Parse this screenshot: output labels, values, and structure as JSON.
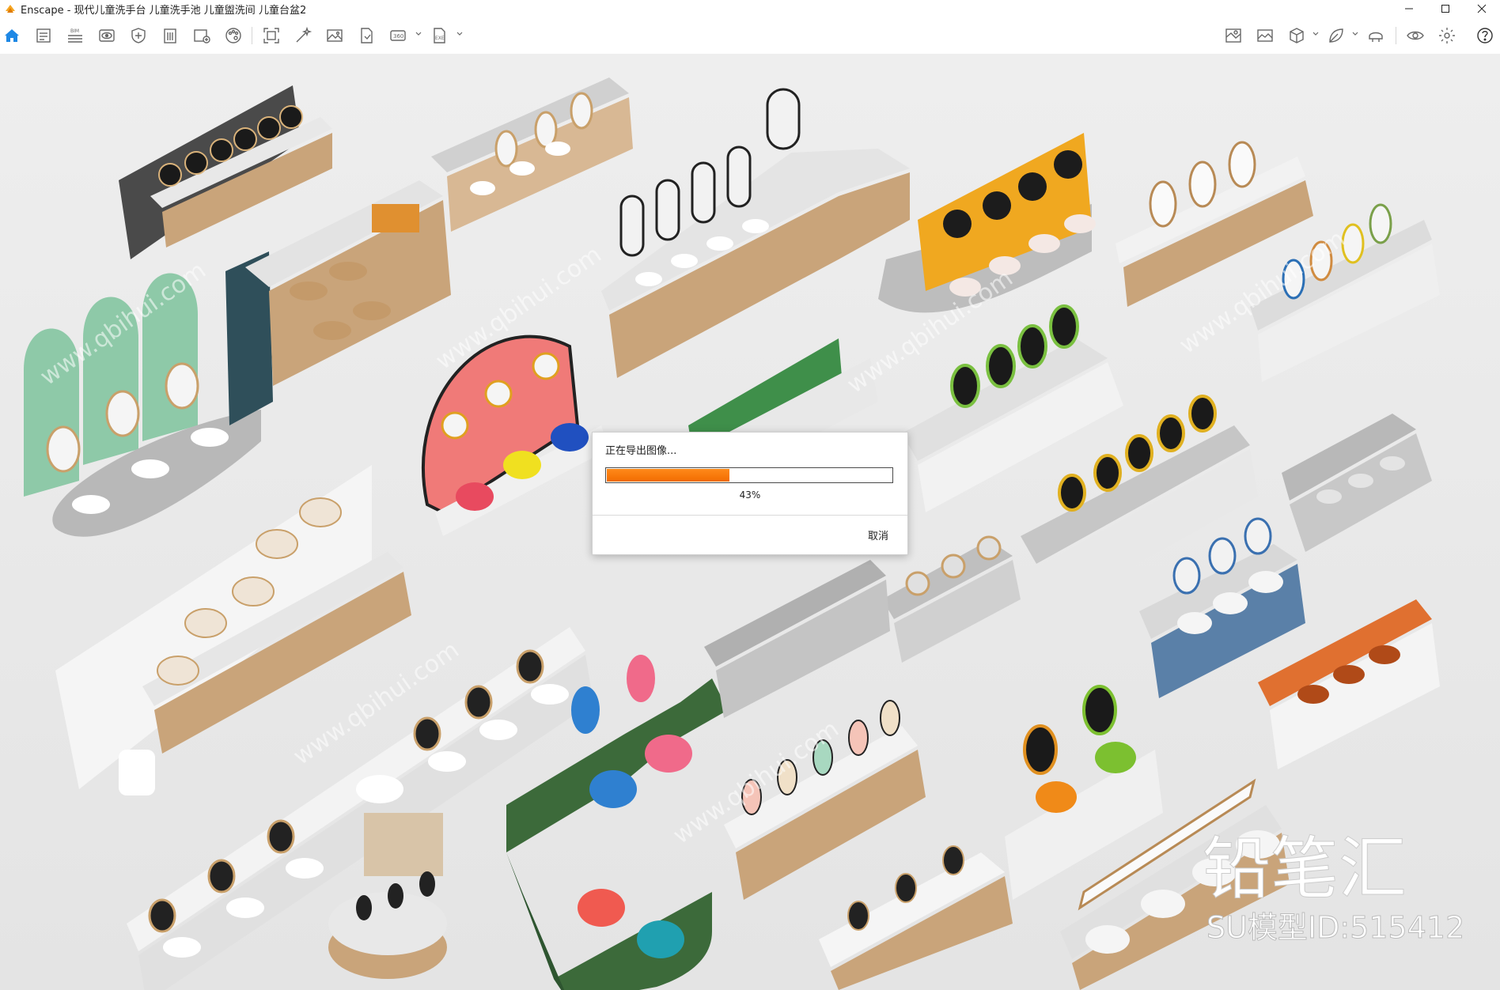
{
  "window": {
    "title": "Enscape - 现代儿童洗手台 儿童洗手池 儿童盥洗间 儿童台盆2",
    "accent_color": "#f5a623"
  },
  "toolbar": {
    "home_color": "#1e88e5",
    "left_tools": [
      "home-icon",
      "document-icon",
      "bim-icon",
      "eye-view-icon",
      "asset-shield-icon",
      "building-icon",
      "add-view-icon",
      "palette-icon",
      "capture-frame-icon",
      "magic-wand-icon",
      "image-icon",
      "file-export-icon",
      "panorama-360-icon",
      "exe-export-icon"
    ],
    "bim_label": "BIM",
    "pano_label": "360",
    "exe_label": "EXE",
    "right_tools": [
      "map-icon",
      "image-compare-icon",
      "cube-icon",
      "leaf-icon",
      "headset-vr-icon",
      "visibility-icon",
      "settings-icon",
      "help-icon"
    ]
  },
  "watermark": {
    "brand": "铅笔汇",
    "model_id": "SU模型ID:515412",
    "site": "www.qbihui.com"
  },
  "export_dialog": {
    "title": "正在导出图像...",
    "progress_percent": 43,
    "progress_label": "43%",
    "cancel_label": "取消",
    "progress_color": "#f57c00"
  }
}
